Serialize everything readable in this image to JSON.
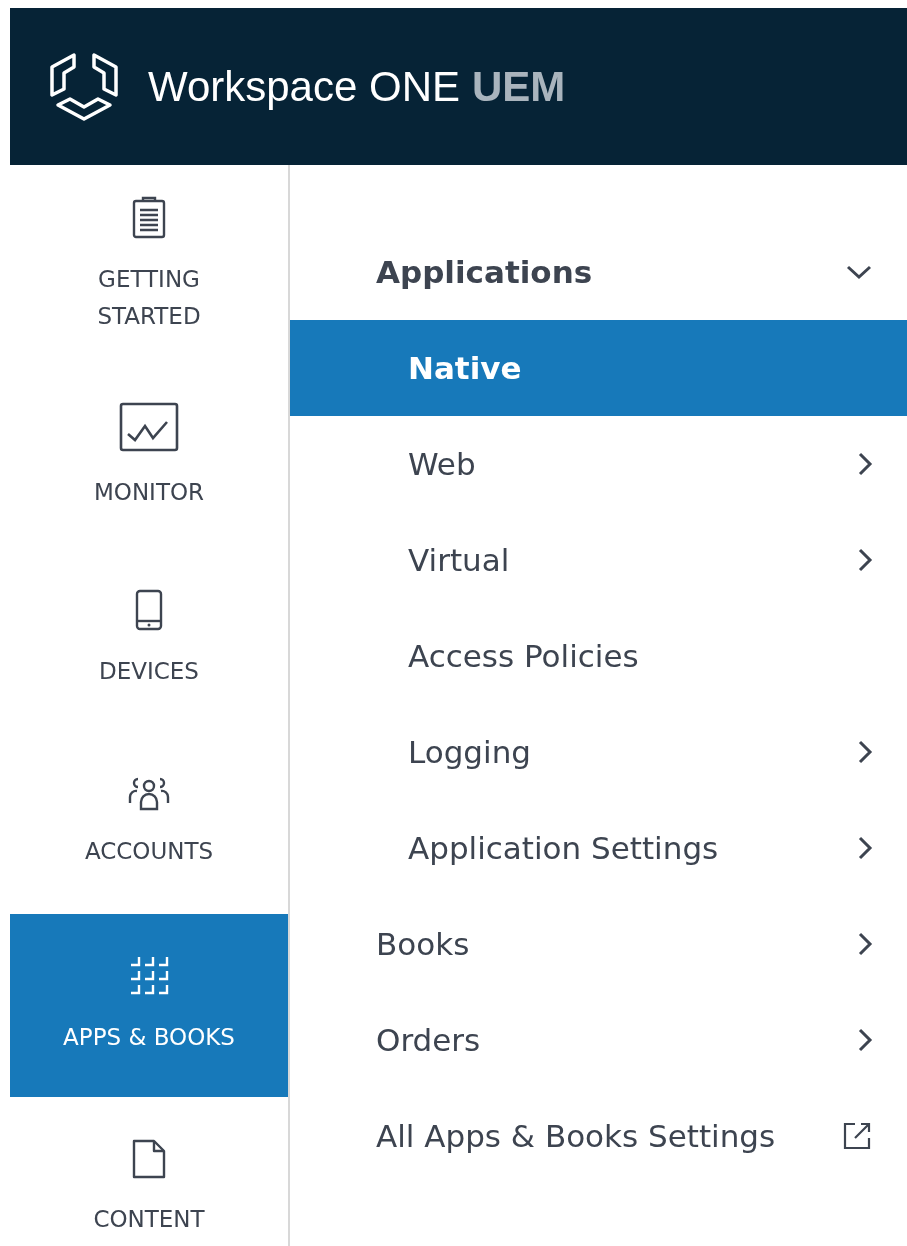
{
  "header": {
    "product": "Workspace ONE",
    "product_suffix": "UEM"
  },
  "sidebar": {
    "items": [
      {
        "kind": "clipboard",
        "label": "GETTING STARTED",
        "selected": false
      },
      {
        "kind": "monitor",
        "label": "MONITOR",
        "selected": false
      },
      {
        "kind": "phone",
        "label": "DEVICES",
        "selected": false
      },
      {
        "kind": "people",
        "label": "ACCOUNTS",
        "selected": false
      },
      {
        "kind": "grid",
        "label": "APPS & BOOKS",
        "selected": true
      },
      {
        "kind": "document",
        "label": "CONTENT",
        "selected": false
      }
    ]
  },
  "menu": {
    "items": [
      {
        "label": "Applications",
        "kind": "group",
        "expanded": true,
        "selected": false,
        "children": [
          {
            "label": "Native",
            "kind": "plain",
            "selected": true
          },
          {
            "label": "Web",
            "kind": "submenu",
            "selected": false
          },
          {
            "label": "Virtual",
            "kind": "submenu",
            "selected": false
          },
          {
            "label": "Access Policies",
            "kind": "plain",
            "selected": false
          },
          {
            "label": "Logging",
            "kind": "submenu",
            "selected": false
          },
          {
            "label": "Application Settings",
            "kind": "submenu",
            "selected": false
          }
        ]
      },
      {
        "label": "Books",
        "kind": "submenu",
        "selected": false
      },
      {
        "label": "Orders",
        "kind": "submenu",
        "selected": false
      },
      {
        "label": "All Apps & Books Settings",
        "kind": "external",
        "selected": false
      }
    ]
  }
}
